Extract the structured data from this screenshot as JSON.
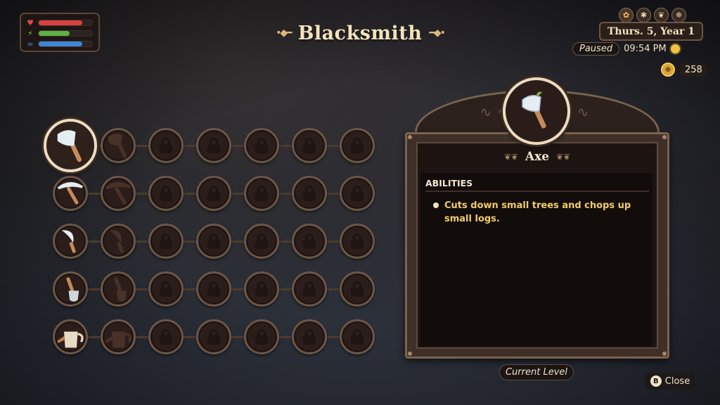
{
  "header": {
    "title": "Blacksmith"
  },
  "player": {
    "health": {
      "icon": "heart-icon",
      "level": 0.82,
      "color": "#d94040"
    },
    "stamina": {
      "icon": "lightning-icon",
      "level": 0.58,
      "color": "#5db241"
    },
    "mana": {
      "icon": "swirl-icon",
      "level": 0.82,
      "color": "#3f86d8"
    }
  },
  "hud": {
    "seasons": [
      "spring-icon",
      "summer-icon",
      "fall-icon",
      "winter-icon"
    ],
    "date": "Thurs. 5, Year 1",
    "status": "Paused",
    "time": "09:54 PM",
    "weather_icon": "sun-icon",
    "coins": "258"
  },
  "tools": [
    {
      "name": "axe",
      "unlocked_icon": "axe-icon",
      "silhouette_icon": "axe-silhouette-icon",
      "selected": true
    },
    {
      "name": "pickaxe",
      "unlocked_icon": "pickaxe-icon",
      "silhouette_icon": "pickaxe-silhouette-icon",
      "selected": false
    },
    {
      "name": "sickle",
      "unlocked_icon": "sickle-icon",
      "silhouette_icon": "sickle-silhouette-icon",
      "selected": false
    },
    {
      "name": "shovel",
      "unlocked_icon": "shovel-icon",
      "silhouette_icon": "shovel-silhouette-icon",
      "selected": false
    },
    {
      "name": "watering-can",
      "unlocked_icon": "watering-can-icon",
      "silhouette_icon": "watering-can-silhouette-icon",
      "selected": false
    }
  ],
  "detail": {
    "tool_name": "Axe",
    "abilities_header": "ABILITIES",
    "abilities": [
      "Cuts down small trees and chops up small logs."
    ],
    "current_level_label": "Current Level"
  },
  "footer": {
    "close_button": "B",
    "close_label": "Close"
  },
  "colors": {
    "accent": "#f2cc6b",
    "frame": "#7a634f",
    "text": "#efe3c9"
  }
}
